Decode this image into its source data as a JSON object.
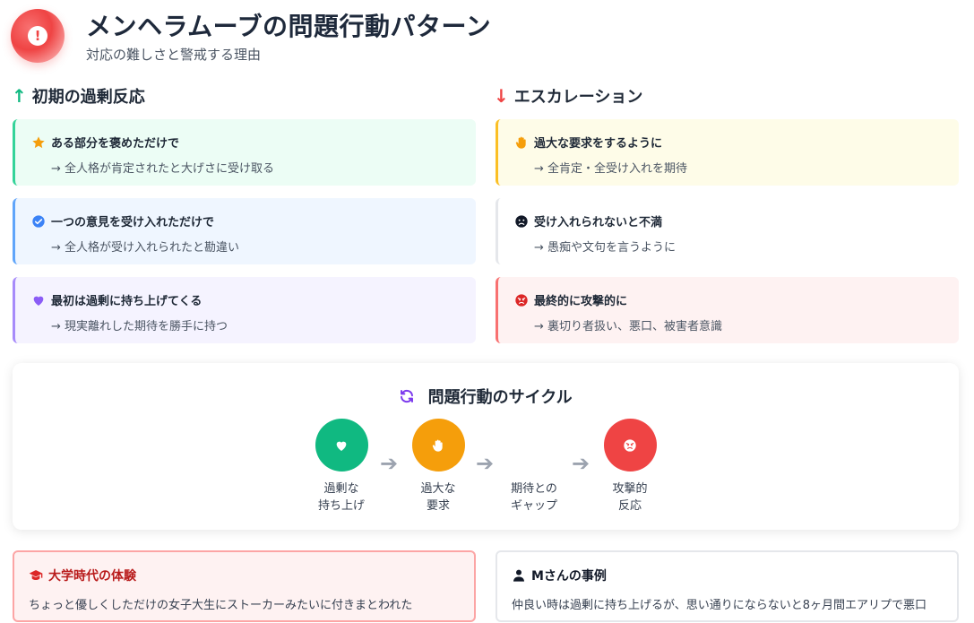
{
  "header": {
    "title": "メンヘラムーブの問題行動パターン",
    "subtitle": "対応の難しさと警戒する理由",
    "icon": "alert-icon"
  },
  "left_column": {
    "title": "初期の過剰反応",
    "icon": "arrow-up-icon",
    "color": "#10b981",
    "cards": [
      {
        "icon": "star-icon",
        "heading": "ある部分を褒めただけで",
        "detail": "→ 全人格が肯定されたと大げさに受け取る",
        "bg": "#ecfdf5",
        "border": "#34d399"
      },
      {
        "icon": "check-circle-icon",
        "heading": "一つの意見を受け入れただけで",
        "detail": "→ 全人格が受け入れられたと勘違い",
        "bg": "#eff6ff",
        "border": "#60a5fa"
      },
      {
        "icon": "heart-icon",
        "heading": "最初は過剰に持ち上げてくる",
        "detail": "→ 現実離れした期待を勝手に持つ",
        "bg": "#f5f3ff",
        "border": "#a78bfa"
      }
    ]
  },
  "right_column": {
    "title": "エスカレーション",
    "icon": "arrow-down-icon",
    "color": "#ef4444",
    "cards": [
      {
        "icon": "hand-icon",
        "heading": "過大な要求をするように",
        "detail": "→ 全肯定・全受け入れを期待",
        "bg": "#fefce8",
        "border": "#fbbf24"
      },
      {
        "icon": "frown-icon",
        "heading": "受け入れられないと不満",
        "detail": "→ 愚痴や文句を言うように",
        "bg": "#ffffff",
        "border": "#e5e7eb"
      },
      {
        "icon": "angry-icon",
        "heading": "最終的に攻撃的に",
        "detail": "→ 裏切り者扱い、悪口、被害者意識",
        "bg": "#fef2f2",
        "border": "#f87171"
      }
    ]
  },
  "cycle": {
    "title": "問題行動のサイクル",
    "icon": "sync-icon",
    "steps": [
      {
        "label": "過剰な\n持ち上げ",
        "icon": "heart-icon",
        "color": "#10b981"
      },
      {
        "label": "過大な\n要求",
        "icon": "hand-icon",
        "color": "#f59e0b"
      },
      {
        "label": "期待との\nギャップ",
        "icon": "",
        "color": ""
      },
      {
        "label": "攻撃的\n反応",
        "icon": "angry-icon",
        "color": "#ef4444"
      }
    ]
  },
  "cases": [
    {
      "icon": "graduation-cap-icon",
      "title": "大学時代の体験",
      "body": "ちょっと優しくしただけの女子大生にストーカーみたいに付きまとわれた",
      "bg": "#fef2f2",
      "border": "#fca5a5",
      "title_color": "#b91c1c"
    },
    {
      "icon": "user-icon",
      "title": "Mさんの事例",
      "body": "仲良い時は過剰に持ち上げるが、思い通りにならないと8ヶ月間エアリプで悪口",
      "bg": "#ffffff",
      "border": "#e5e7eb",
      "title_color": "#111827"
    }
  ]
}
